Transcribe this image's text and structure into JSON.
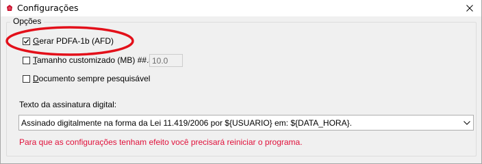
{
  "window": {
    "title": "Configurações",
    "app_icon": "red-app-icon",
    "close_icon": "close-icon"
  },
  "options_group": {
    "legend": "Opções",
    "gerar_pdfa": {
      "label": "Gerar PDFA-1b (AFD)",
      "checked": true
    },
    "tamanho_customizado": {
      "label": "Tamanho customizado (MB) ##.#",
      "checked": false,
      "value": "10.0"
    },
    "documento_pesquisavel": {
      "label": "Documento sempre pesquisável",
      "checked": false
    }
  },
  "signature": {
    "label": "Texto da assinatura digital:",
    "value": "Assinado digitalmente na forma da Lei 11.419/2006 por ${USUARIO} em: ${DATA_HORA}."
  },
  "warning": "Para que as configurações tenham efeito você precisará reiniciar o programa.",
  "colors": {
    "annotation_ellipse": "#e3101a",
    "warning_text": "#e0103a"
  }
}
